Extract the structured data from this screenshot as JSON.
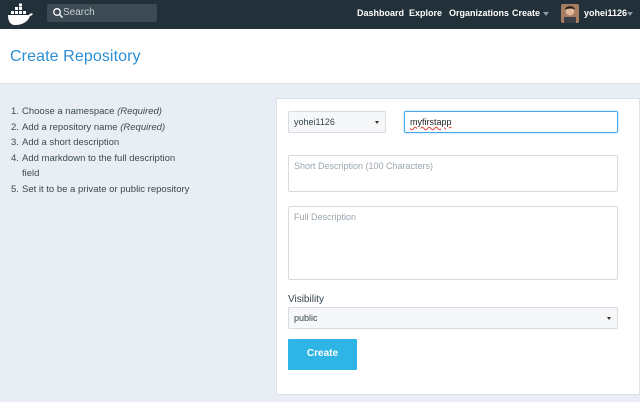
{
  "nav": {
    "search_placeholder": "Search",
    "links": [
      "Dashboard",
      "Explore",
      "Organizations",
      "Create"
    ],
    "username": "yohei1126"
  },
  "page": {
    "title": "Create Repository"
  },
  "steps": [
    {
      "num": "1.",
      "text": "Choose a namespace ",
      "em": "(Required)"
    },
    {
      "num": "2.",
      "text": "Add a repository name ",
      "em": "(Required)"
    },
    {
      "num": "3.",
      "text": "Add a short description",
      "em": ""
    },
    {
      "num": "4.",
      "text": "Add markdown to the full description",
      "em": ""
    },
    {
      "num": "",
      "text": "field",
      "em": ""
    },
    {
      "num": "5.",
      "text": "Set it to be a private or public repository",
      "em": ""
    }
  ],
  "form": {
    "namespace_value": "yohei1126",
    "repo_name_value": "myfirstapp",
    "short_description_placeholder": "Short Description (100 Characters)",
    "full_description_placeholder": "Full Description",
    "visibility_label": "Visibility",
    "visibility_value": "public",
    "create_label": "Create"
  },
  "colors": {
    "topbar": "#22303a",
    "title": "#2a8ed4",
    "button": "#2eb5e5",
    "background": "#e8eef3"
  }
}
